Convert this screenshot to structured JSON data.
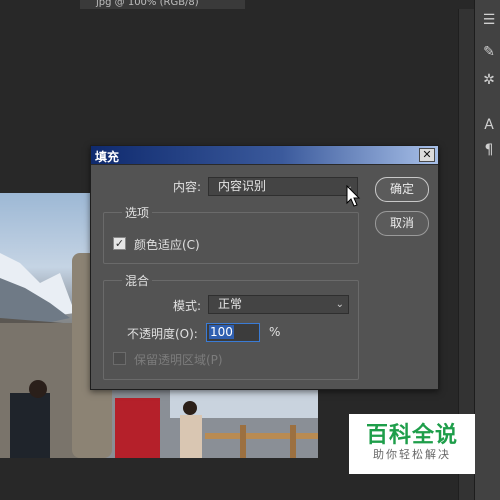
{
  "doc_tab": {
    "label": "jpg @ 100% (RGB/8)"
  },
  "dialog": {
    "title": "填充",
    "close_glyph": "✕",
    "content_label": "内容:",
    "content_value": "内容识别",
    "options_group": "选项",
    "color_adapt_label": "颜色适应(C)",
    "color_adapt_checked": true,
    "blend_group": "混合",
    "mode_label": "模式:",
    "mode_value": "正常",
    "opacity_label": "不透明度(O):",
    "opacity_value": "100",
    "opacity_unit": "%",
    "preserve_label": "保留透明区域(P)",
    "ok_label": "确定",
    "cancel_label": "取消"
  },
  "right_panel": {
    "icons": [
      "adjust-icon",
      "brush-settings-icon",
      "clone-source-icon",
      "character-icon",
      "paragraph-icon"
    ]
  },
  "watermark": {
    "main": "百科全说",
    "sub": "助你轻松解决"
  }
}
